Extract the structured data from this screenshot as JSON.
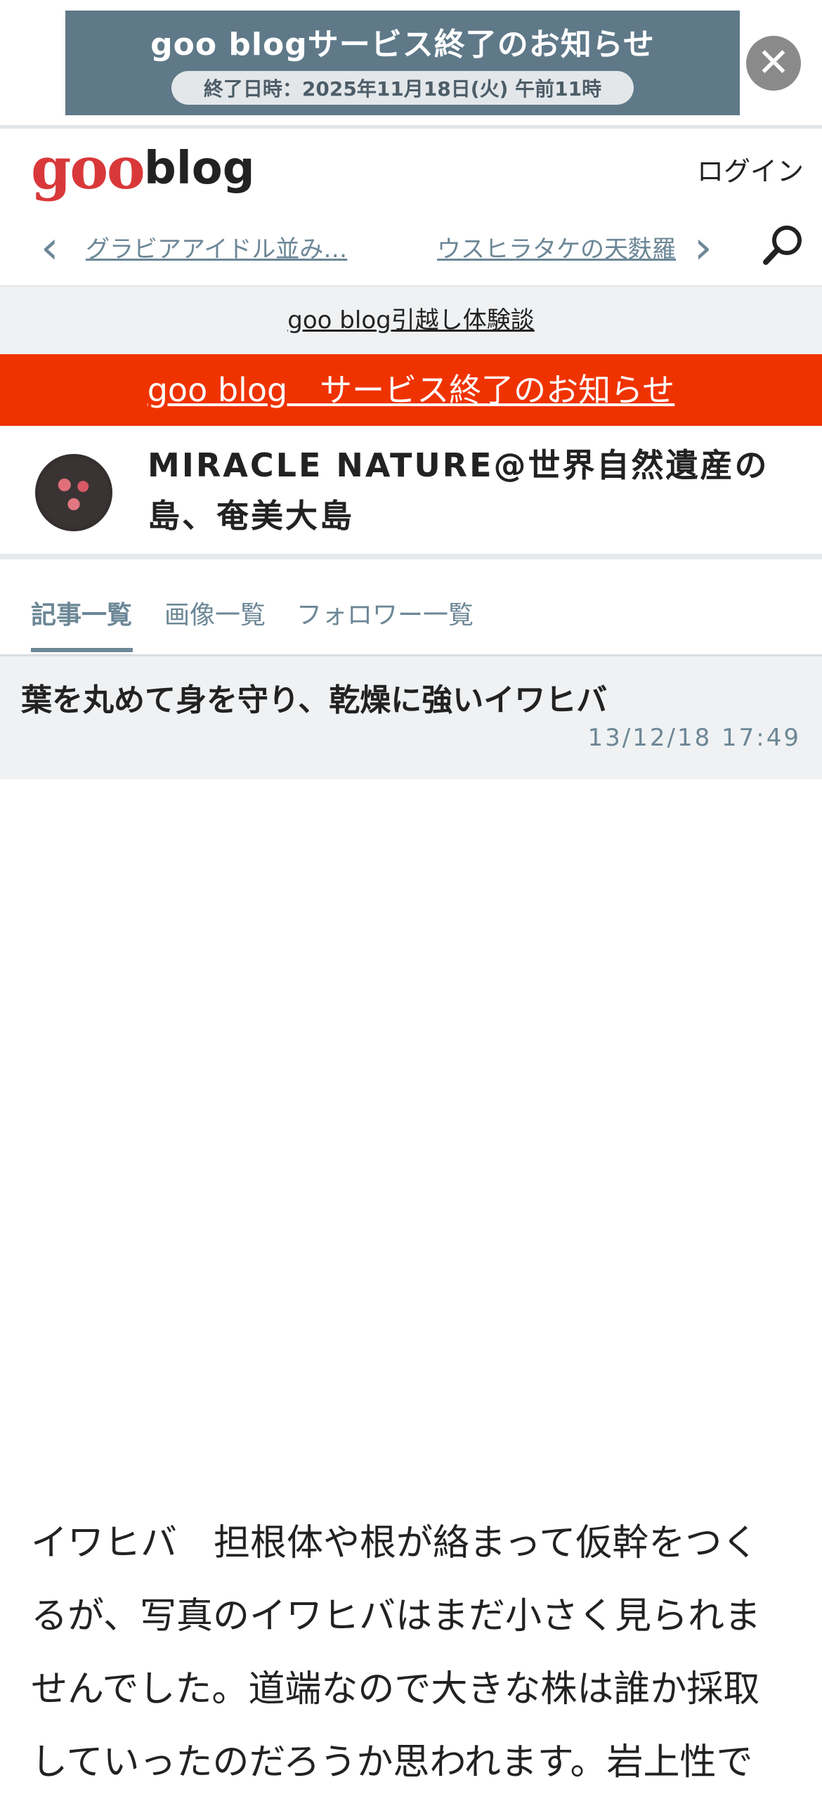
{
  "banner": {
    "title": "goo blogサービス終了のお知らせ",
    "date": "終了日時：2025年11月18日(火) 午前11時",
    "close_symbol": "✕"
  },
  "header": {
    "logo_goo": "goo",
    "logo_blog": "blog",
    "login_label": "ログイン"
  },
  "nav": {
    "prev_label": "グラビアアイドル並み…",
    "next_label": "ウスヒラタケの天麩羅",
    "prev_icon": "chevron-left-icon",
    "next_icon": "chevron-right-icon",
    "search_icon": "search-icon"
  },
  "migration_label": "goo blog引越し体験談",
  "notice_label": "goo blog　サービス終了のお知らせ",
  "blog": {
    "title": "MIRACLE NATURE@世界自然遺産の島、奄美大島"
  },
  "tabs": [
    "記事一覧",
    "画像一覧",
    "フォロワー一覧"
  ],
  "article": {
    "title": "葉を丸めて身を守り、乾燥に強いイワヒバ",
    "date": "13/12/18 17:49",
    "body": "イワヒバ　担根体や根が絡まって仮幹をつくるが、写真のイワヒバはまだ小さく見られませんでした。道端なので大きな株は誰か採取していったのだろうか思われます。岩上性で"
  },
  "colors": {
    "notice_red": "#ef3300",
    "accent_blue_gray": "#6c8796",
    "logo_red": "#d9383a"
  }
}
